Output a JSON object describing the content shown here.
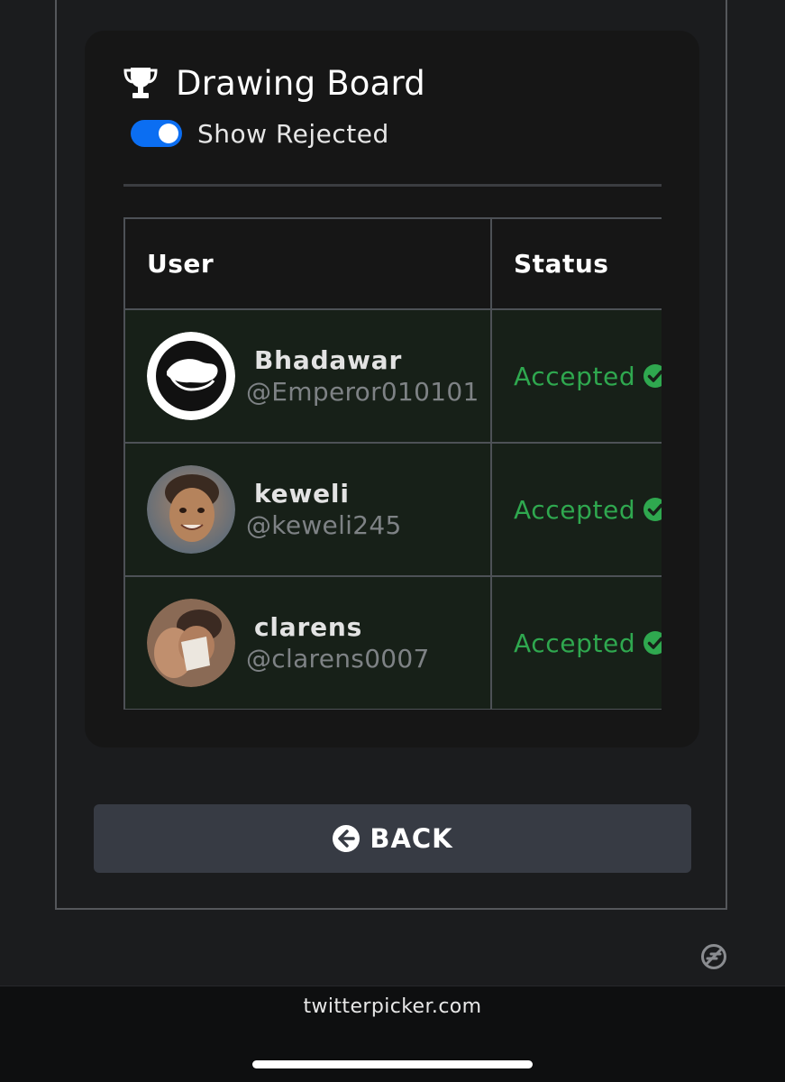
{
  "card": {
    "title": "Drawing Board",
    "title_icon": "trophy-icon",
    "toggle": {
      "label": "Show Rejected",
      "on": true,
      "accent": "#0b6ef2"
    }
  },
  "table": {
    "headers": {
      "user": "User",
      "status": "Status"
    },
    "rows": [
      {
        "name": "Bhadawar",
        "handle": "@Emperor010101",
        "status": "Accepted",
        "status_icon": "check-circle-icon"
      },
      {
        "name": "keweli",
        "handle": "@keweli245",
        "status": "Accepted",
        "status_icon": "check-circle-icon"
      },
      {
        "name": "clarens",
        "handle": "@clarens0007",
        "status": "Accepted",
        "status_icon": "check-circle-icon"
      }
    ],
    "status_color": "#2fa84f"
  },
  "back_button": {
    "label": "BACK",
    "icon": "arrow-left-circle-icon"
  },
  "browser": {
    "url": "twitterpicker.com"
  }
}
